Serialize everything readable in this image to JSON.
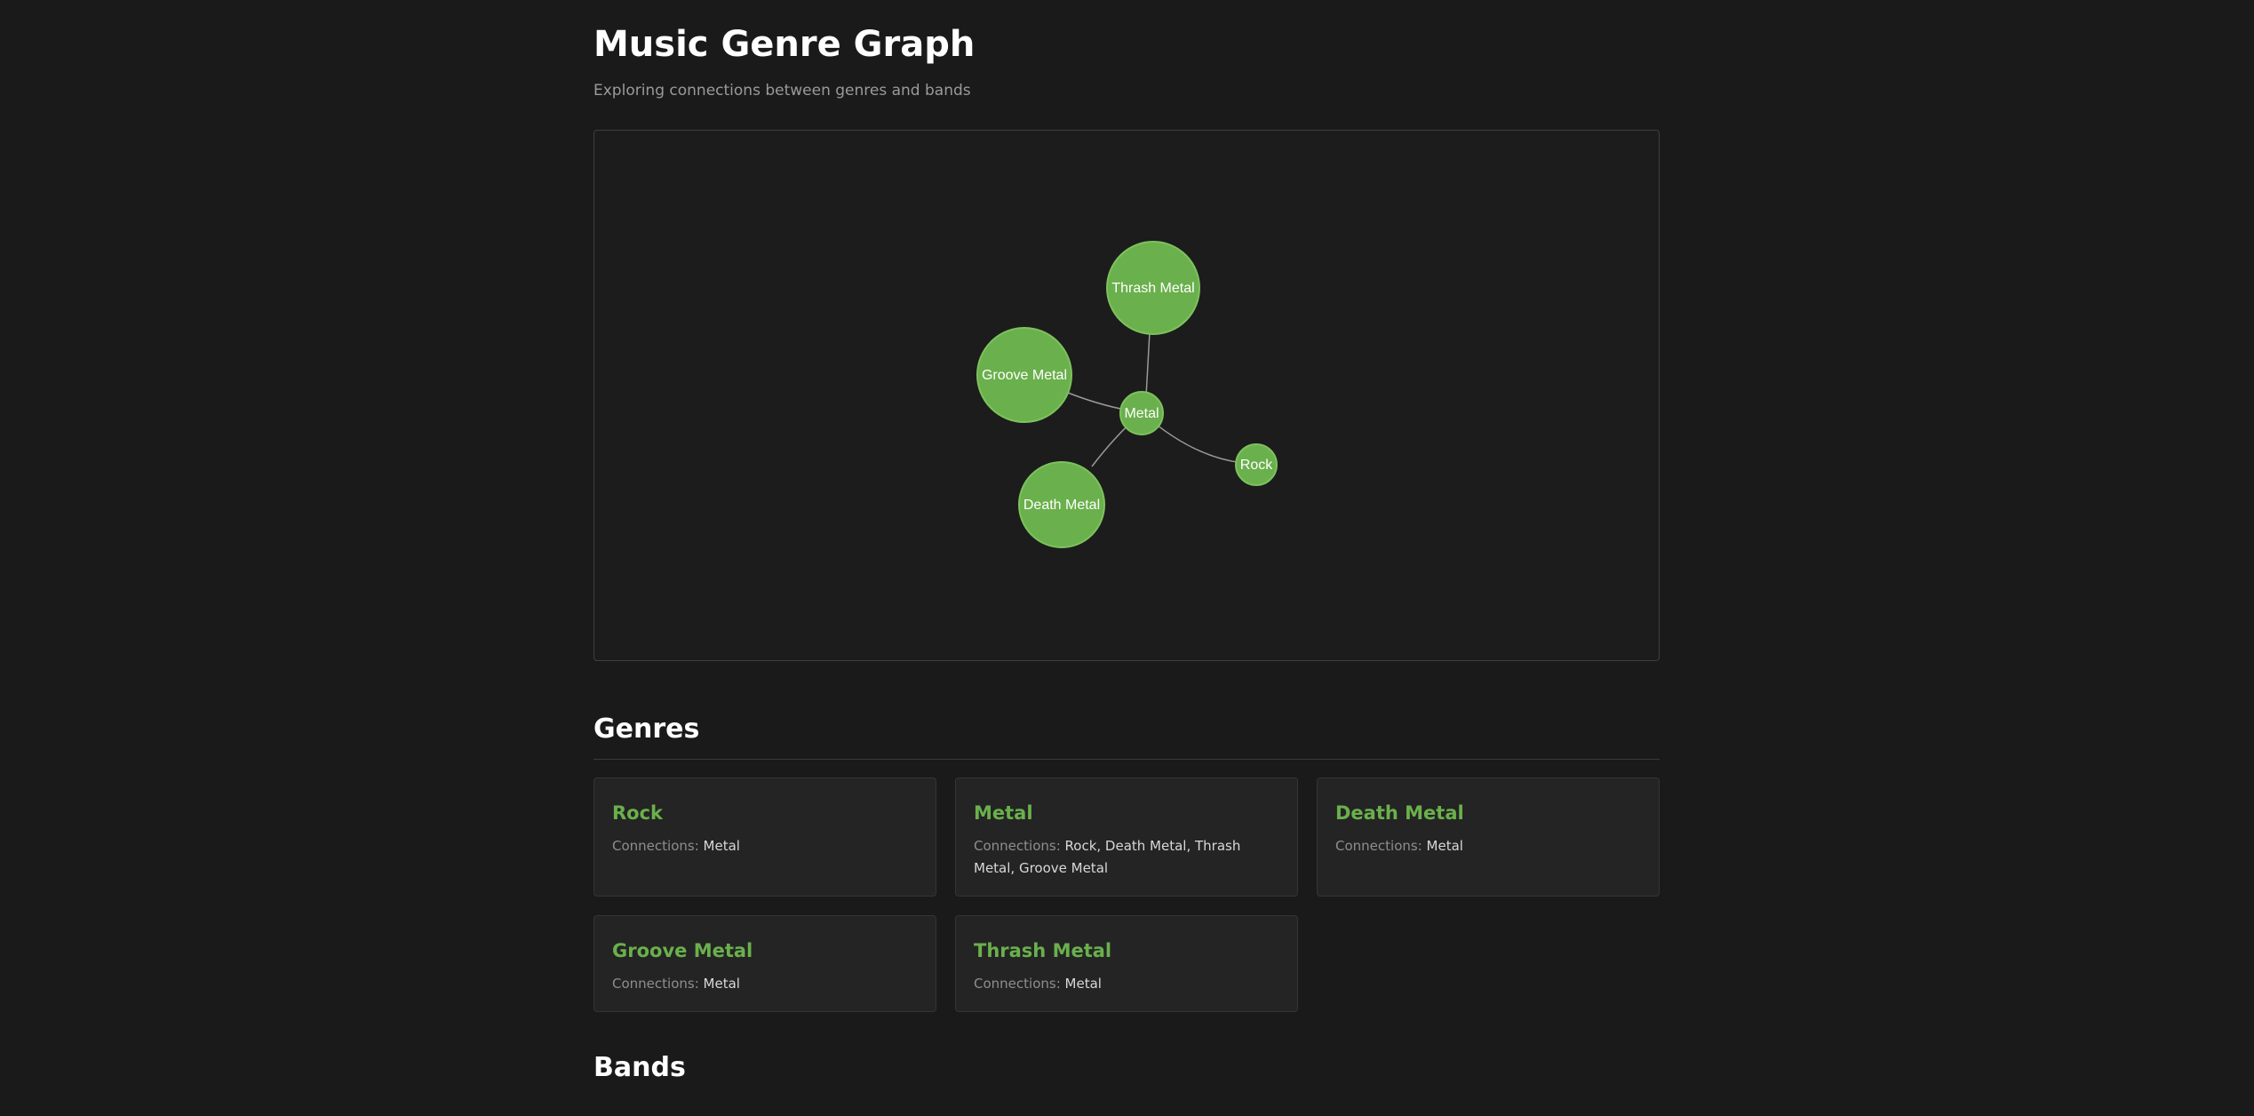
{
  "header": {
    "title": "Music Genre Graph",
    "subtitle": "Exploring connections between genres and bands"
  },
  "graph": {
    "node_color": "#6ab04c",
    "edge_color": "#9a9a9a",
    "nodes": [
      {
        "id": "metal",
        "label": "Metal"
      },
      {
        "id": "thrash",
        "label": "Thrash Metal"
      },
      {
        "id": "groove",
        "label": "Groove Metal"
      },
      {
        "id": "death",
        "label": "Death Metal"
      },
      {
        "id": "rock",
        "label": "Rock"
      }
    ],
    "edges": [
      {
        "source": "metal",
        "target": "thrash"
      },
      {
        "source": "metal",
        "target": "groove"
      },
      {
        "source": "metal",
        "target": "death"
      },
      {
        "source": "metal",
        "target": "rock"
      }
    ]
  },
  "genres": {
    "title": "Genres",
    "connections_label": "Connections:",
    "items": [
      {
        "name": "Rock",
        "connections": "Metal"
      },
      {
        "name": "Metal",
        "connections": "Rock, Death Metal, Thrash Metal, Groove Metal"
      },
      {
        "name": "Death Metal",
        "connections": "Metal"
      },
      {
        "name": "Groove Metal",
        "connections": "Metal"
      },
      {
        "name": "Thrash Metal",
        "connections": "Metal"
      }
    ]
  },
  "bands": {
    "title": "Bands"
  }
}
